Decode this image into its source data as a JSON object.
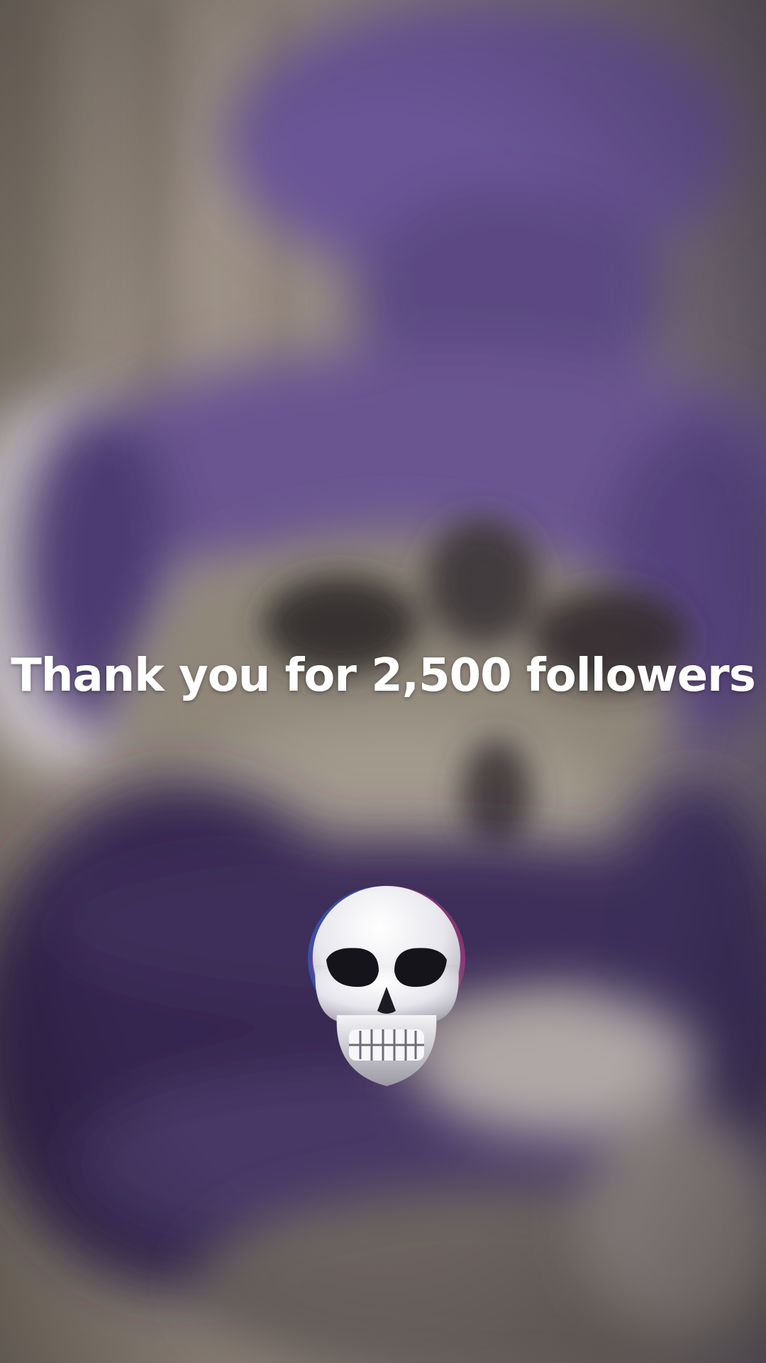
{
  "caption": {
    "text": "Thank you for 2,500 followers"
  },
  "emoji": {
    "name": "skull-icon",
    "glyph": "💀"
  },
  "colors": {
    "accent_purple": "#5a4585",
    "text": "#ffffff"
  }
}
